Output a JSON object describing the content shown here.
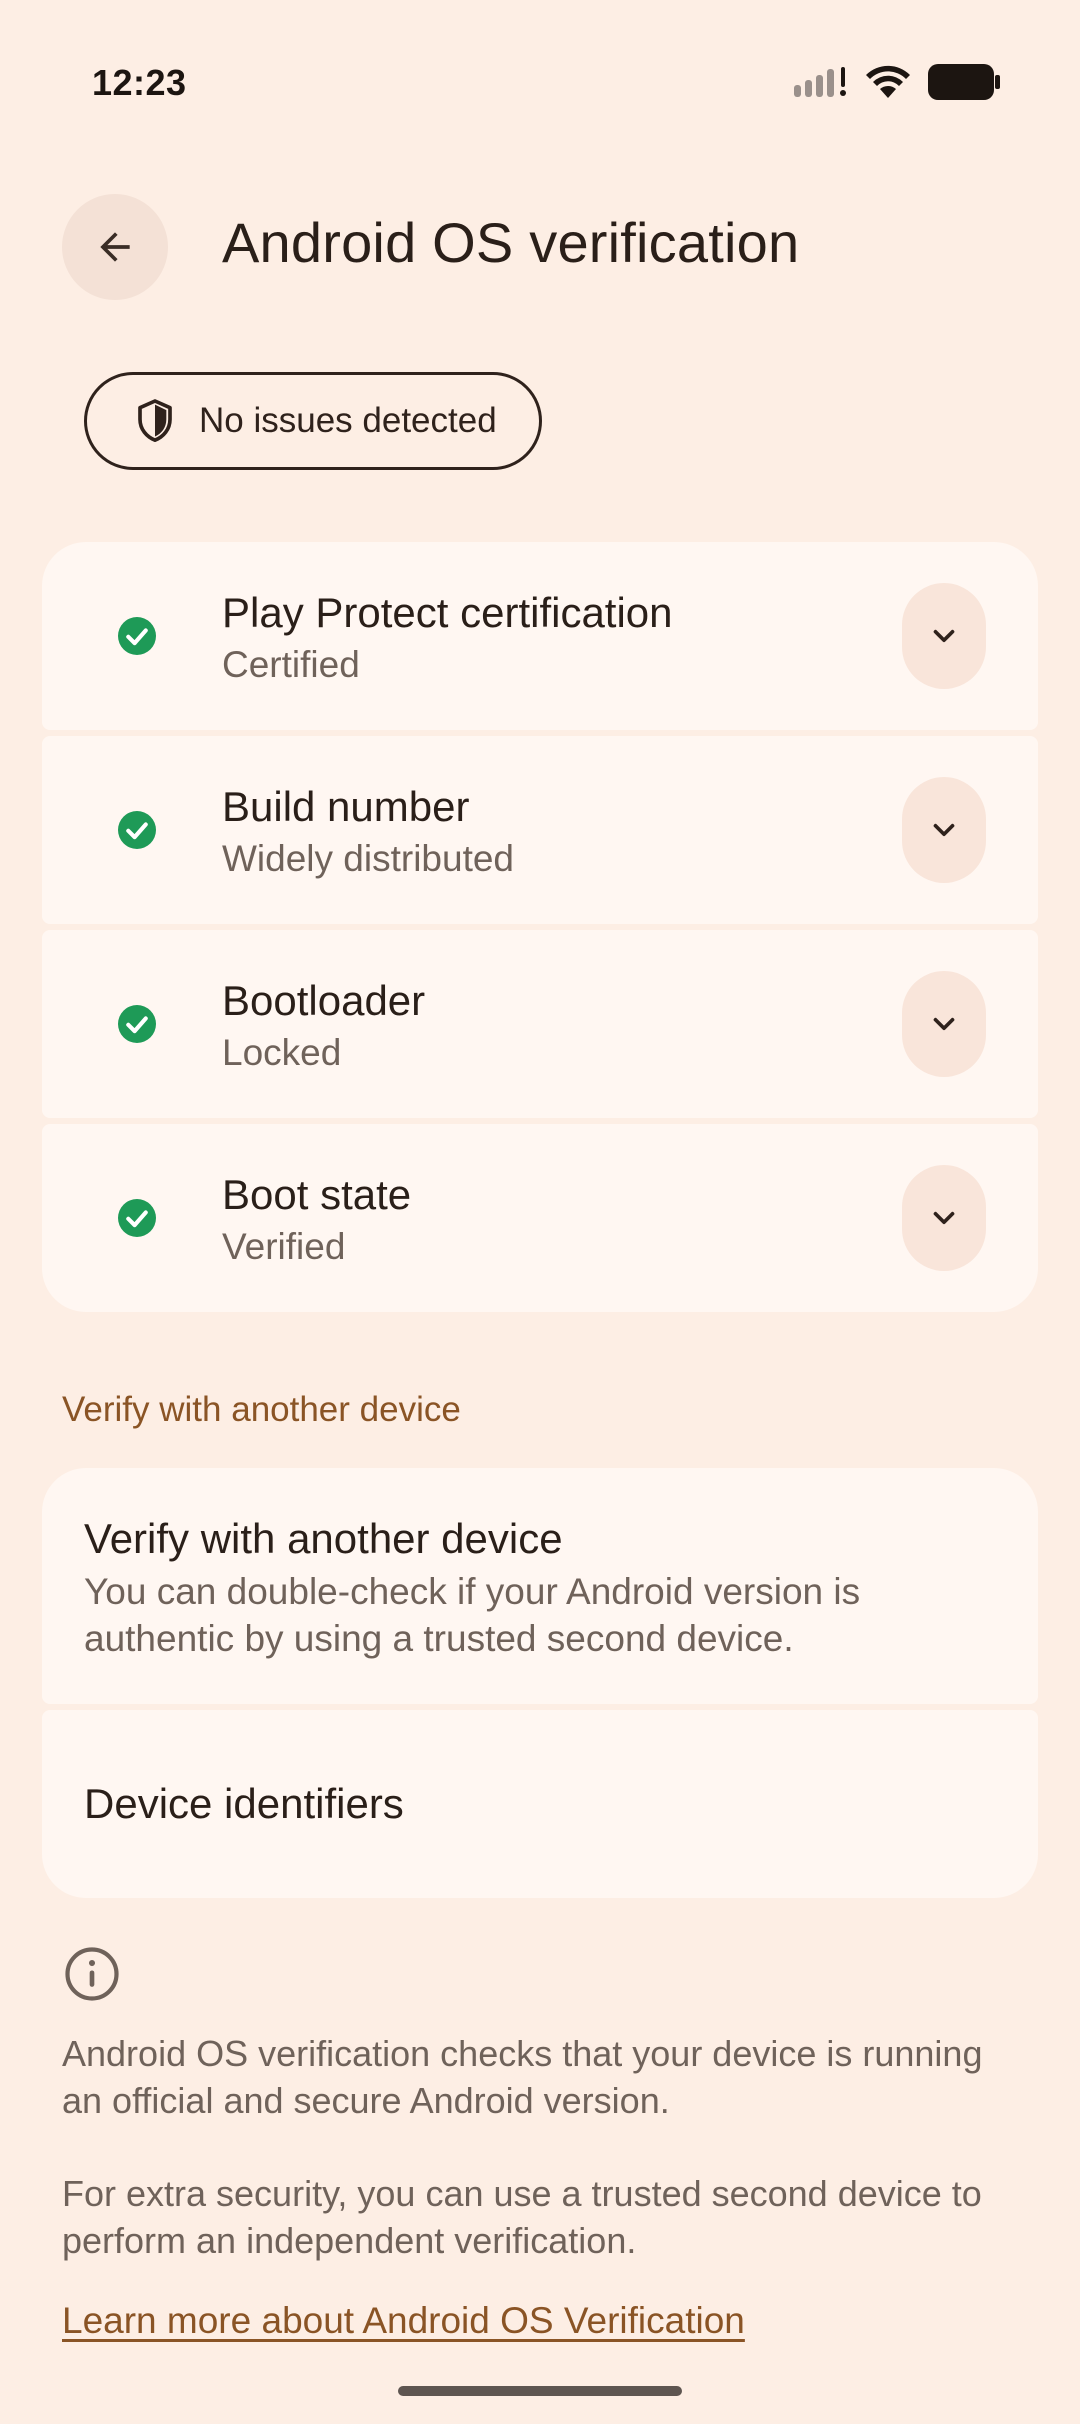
{
  "status_bar": {
    "time": "12:23",
    "icons": [
      "signal-icon",
      "wifi-icon",
      "battery-icon"
    ]
  },
  "header": {
    "back_icon": "arrow-back-icon",
    "title": "Android OS verification"
  },
  "status_chip": {
    "icon": "shield-icon",
    "label": "No issues detected"
  },
  "checks": [
    {
      "title": "Play Protect certification",
      "status": "Certified",
      "icon": "check-circle-icon"
    },
    {
      "title": "Build number",
      "status": "Widely distributed",
      "icon": "check-circle-icon"
    },
    {
      "title": "Bootloader",
      "status": "Locked",
      "icon": "check-circle-icon"
    },
    {
      "title": "Boot state",
      "status": "Verified",
      "icon": "check-circle-icon"
    }
  ],
  "verify_section": {
    "header": "Verify with another device",
    "card_title": "Verify with another device",
    "card_description": "You can double-check if your Android version is authentic by using a trusted second device.",
    "identifiers_label": "Device identifiers"
  },
  "footer": {
    "info_icon": "info-icon",
    "paragraph_1": "Android OS verification checks that your device is running an official and secure Android version.",
    "paragraph_2": "For extra security, you can use a trusted second device to perform an independent verification.",
    "learn_more": "Learn more about Android OS Verification"
  },
  "colors": {
    "background": "#fdeee4",
    "card": "#fff7f2",
    "accent": "#8a5425",
    "success": "#1e9a57"
  }
}
